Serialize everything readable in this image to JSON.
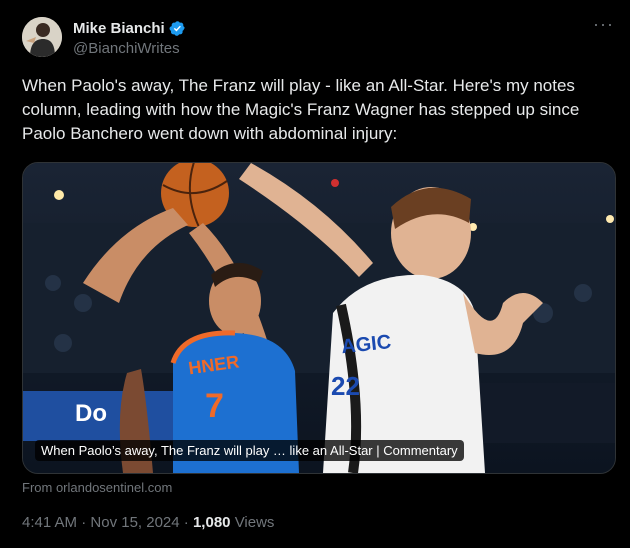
{
  "author": {
    "display_name": "Mike Bianchi",
    "handle": "@BianchiWrites"
  },
  "tweet": {
    "text": "When Paolo's away, The Franz will play - like an All-Star. Here's my notes column, leading with how the Magic's Franz Wagner has stepped up since Paolo Banchero went down with abdominal injury:"
  },
  "card": {
    "headline": "When Paolo’s away, The Franz will play … like an All-Star | Commentary",
    "source": "From orlandosentinel.com",
    "image": {
      "jersey_left_text": "HNER",
      "jersey_left_number": "7",
      "jersey_right_text": "AGIC",
      "jersey_right_number": "22",
      "board_text": "Do"
    }
  },
  "meta": {
    "time": "4:41 AM",
    "separator": "·",
    "date": "Nov 15, 2024",
    "views_count": "1,080",
    "views_label": "Views"
  },
  "colors": {
    "verified": "#1d9bf0",
    "thunder_blue": "#1d70d1",
    "thunder_orange": "#ef6a29"
  },
  "icons": [
    "verified-badge-icon",
    "more-options-icon"
  ]
}
